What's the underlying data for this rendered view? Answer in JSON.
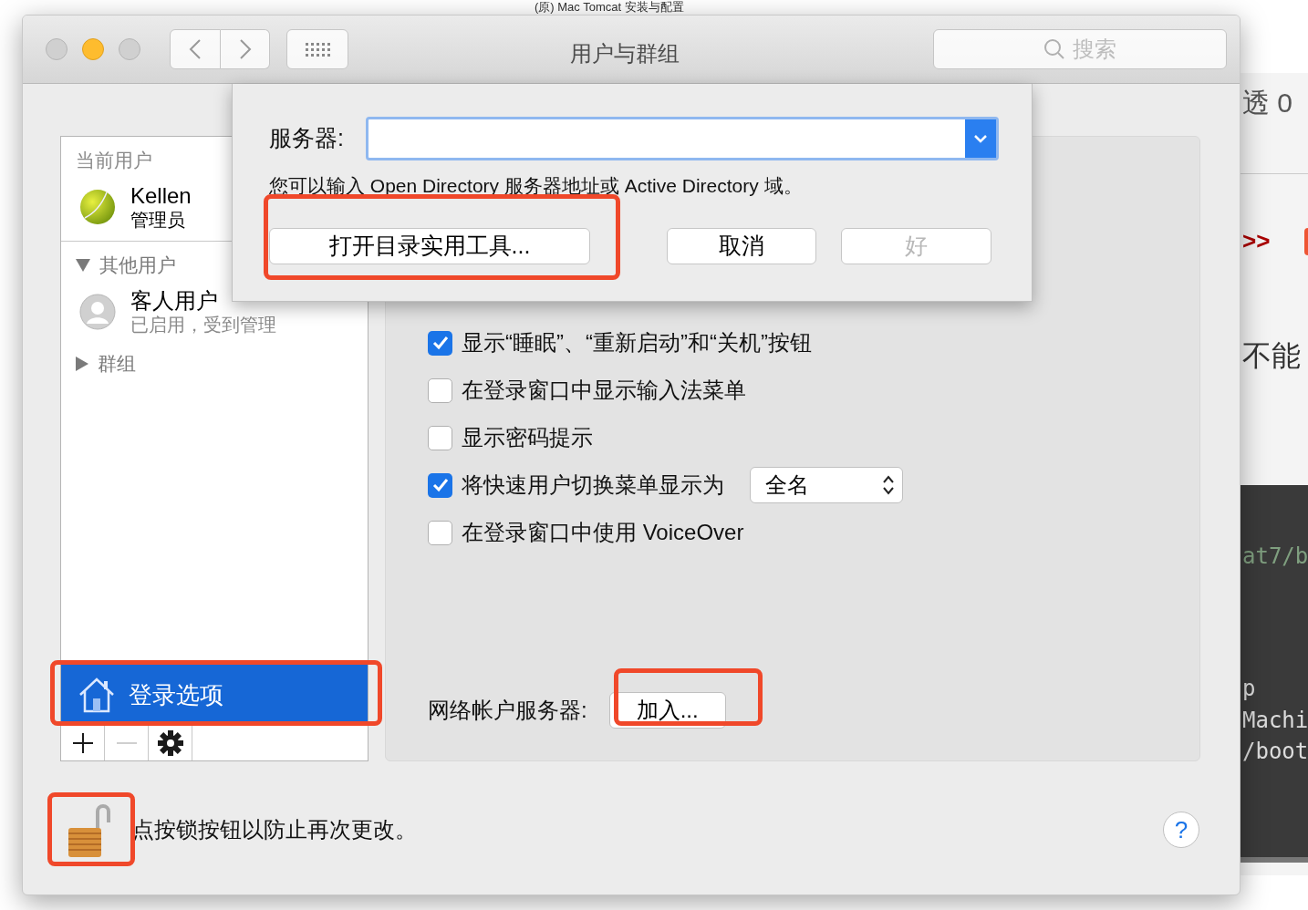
{
  "background_page": {
    "title": "(原) Mac Tomcat 安装与配置",
    "side_texts": [
      {
        "kind": "plain",
        "text": "透 0"
      },
      {
        "kind": "accent",
        "text": ">>"
      },
      {
        "kind": "large",
        "text": "不能"
      }
    ],
    "code_lines": [
      {
        "kind": "path",
        "text": "at7/b"
      },
      {
        "kind": "plain",
        "text": "p"
      },
      {
        "kind": "plain",
        "text": "Machi"
      },
      {
        "kind": "plain",
        "text": "/boot"
      }
    ]
  },
  "window": {
    "title": "用户与群组",
    "search": {
      "placeholder": "搜索"
    },
    "lights": [
      {
        "kind": "close",
        "enabled": false
      },
      {
        "kind": "minimize",
        "enabled": true
      },
      {
        "kind": "zoom",
        "enabled": false
      }
    ]
  },
  "sidebar": {
    "sections": [
      {
        "kind": "plain",
        "label": "当前用户",
        "users": [
          {
            "name": "Kellen",
            "role": "管理员",
            "kind": "ball"
          }
        ]
      },
      {
        "kind": "disclosure",
        "label": "其他用户",
        "expanded": true,
        "users": [
          {
            "name": "客人用户",
            "role": "已启用，受到管理",
            "kind": "silhouette"
          }
        ]
      },
      {
        "kind": "disclosure",
        "label": "群组",
        "expanded": false
      }
    ],
    "footer_item": {
      "label": "登录选项",
      "selected": true
    },
    "tools": [
      {
        "kind": "add",
        "disabled": false
      },
      {
        "kind": "remove",
        "disabled": true
      },
      {
        "kind": "gear",
        "disabled": false
      }
    ]
  },
  "options": [
    {
      "kind": "checkbox",
      "label": "显示“睡眠”、“重新启动”和“关机”按钮",
      "checked": true
    },
    {
      "kind": "checkbox",
      "label": "在登录窗口中显示输入法菜单",
      "checked": false
    },
    {
      "kind": "checkbox",
      "label": "显示密码提示",
      "checked": false
    },
    {
      "kind": "checkbox_popup",
      "label": "将快速用户切换菜单显示为",
      "checked": true,
      "value": "全名"
    },
    {
      "kind": "checkbox",
      "label": "在登录窗口中使用 VoiceOver",
      "checked": false
    }
  ],
  "network": {
    "label": "网络帐户服务器:",
    "button": "加入..."
  },
  "lock": {
    "locked": false,
    "text": "点按锁按钮以防止再次更改。"
  },
  "help": "?",
  "sheet": {
    "server_label": "服务器:",
    "note": "您可以输入 Open Directory 服务器地址或 Active Directory 域。",
    "buttons": [
      {
        "label": "打开目录实用工具...",
        "disabled": false
      },
      {
        "label": "取消",
        "disabled": false
      },
      {
        "label": "好",
        "disabled": true
      }
    ]
  },
  "annotations": [
    {
      "kind": "sheet_button"
    },
    {
      "kind": "sidebar_footer"
    },
    {
      "kind": "join_button"
    },
    {
      "kind": "lock"
    }
  ]
}
